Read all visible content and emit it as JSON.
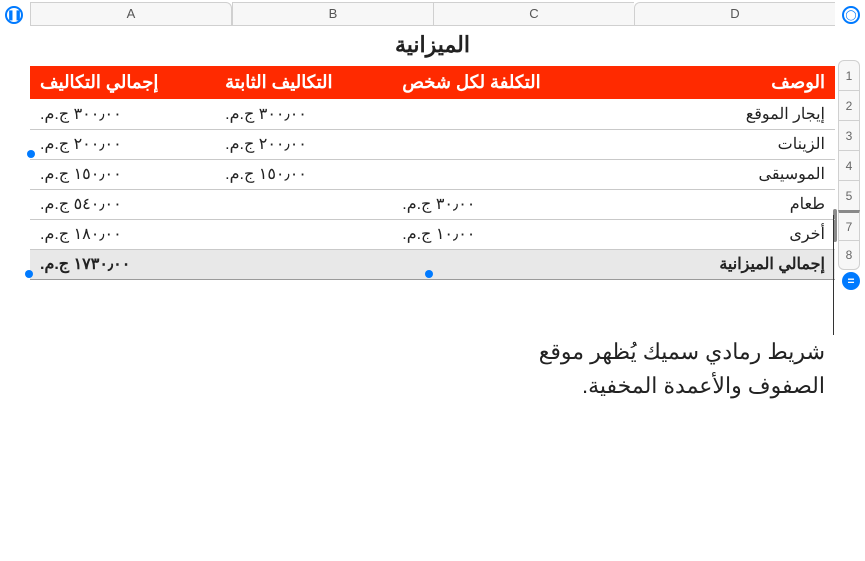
{
  "title": "الميزانية",
  "columns": [
    "A",
    "B",
    "C",
    "D"
  ],
  "row_nums": [
    "1",
    "2",
    "3",
    "4",
    "5",
    "7",
    "8"
  ],
  "headers": {
    "desc": "الوصف",
    "per": "التكلفة لكل شخص",
    "fixed": "التكاليف الثابتة",
    "total": "إجمالي التكاليف"
  },
  "rows": [
    {
      "desc": "إيجار الموقع",
      "per": "",
      "fixed": "٣٠٠٫٠٠ ج.م.",
      "total": "٣٠٠٫٠٠ ج.م."
    },
    {
      "desc": "الزينات",
      "per": "",
      "fixed": "٢٠٠٫٠٠ ج.م.",
      "total": "٢٠٠٫٠٠ ج.م."
    },
    {
      "desc": "الموسيقى",
      "per": "",
      "fixed": "١٥٠٫٠٠ ج.م.",
      "total": "١٥٠٫٠٠ ج.م."
    },
    {
      "desc": "طعام",
      "per": "٣٠٫٠٠ ج.م.",
      "fixed": "",
      "total": "٥٤٠٫٠٠ ج.م."
    },
    {
      "desc": "أخرى",
      "per": "١٠٫٠٠ ج.م.",
      "fixed": "",
      "total": "١٨٠٫٠٠ ج.م."
    }
  ],
  "total_row": {
    "label": "إجمالي الميزانية",
    "value": "١٧٣٠٫٠٠ ج.م."
  },
  "callout": "شريط رمادي سميك يُظهر موقع الصفوف والأعمدة المخفية.",
  "icons": {
    "cols": "○",
    "pause": "⏸",
    "eq": "="
  }
}
